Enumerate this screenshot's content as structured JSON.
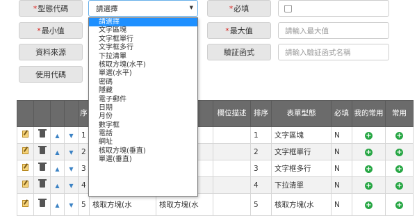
{
  "form": {
    "type_code_label": "型態代碼",
    "type_code_value": "請選擇",
    "required_label": "必填",
    "min_label": "最小值",
    "min_placeholder": "",
    "max_label": "最大值",
    "max_placeholder": "請輸入最大值",
    "datasource_label": "資料來源",
    "datasource_placeholder": "",
    "validation_label": "驗証函式",
    "validation_placeholder": "請輸入驗証函式名稱",
    "usecode_label": "使用代碼",
    "required_marker": "*"
  },
  "dropdown": {
    "options": [
      "請選擇",
      "文字區塊",
      "文字框單行",
      "文字框多行",
      "下拉清單",
      "核取方塊(水平)",
      "單選(水平)",
      "密碼",
      "隱藏",
      "電子郵件",
      "日期",
      "月份",
      "數字框",
      "電話",
      "網址",
      "核取方塊(垂直)",
      "單選(垂直)"
    ],
    "selected_index": 0
  },
  "table": {
    "headers": {
      "seq": "序",
      "field_desc": "欄位描述",
      "sort": "排序",
      "form_type": "表單型態",
      "required": "必填",
      "my_common": "我的常用",
      "common": "常用"
    },
    "rows": [
      {
        "seq": "1",
        "type_col": "",
        "field_desc": "",
        "sort": "1",
        "form_type": "文字區塊",
        "required": "N"
      },
      {
        "seq": "2",
        "type_col": "",
        "field_desc": "",
        "sort": "2",
        "form_type": "文字框單行",
        "required": "N"
      },
      {
        "seq": "3",
        "type_col": "",
        "field_desc": "",
        "sort": "3",
        "form_type": "文字框多行",
        "required": "N"
      },
      {
        "seq": "4",
        "type_col": "",
        "field_desc": "",
        "sort": "4",
        "form_type": "下拉清單",
        "required": "N"
      },
      {
        "seq": "5",
        "type_col": "核取方塊(水",
        "field_desc": "核取方塊(水",
        "sort": "5",
        "form_type": "核取方塊(水",
        "required": "N"
      }
    ]
  },
  "icons": {
    "edit": "edit-icon",
    "delete": "trash-icon",
    "up": "arrow-up-icon",
    "down": "arrow-down-icon",
    "add": "plus-circle-icon"
  },
  "colors": {
    "header_bg": "#6b6b6b",
    "required_red": "#d9231d",
    "add_green": "#28a745",
    "select_highlight": "#1e90ff"
  }
}
